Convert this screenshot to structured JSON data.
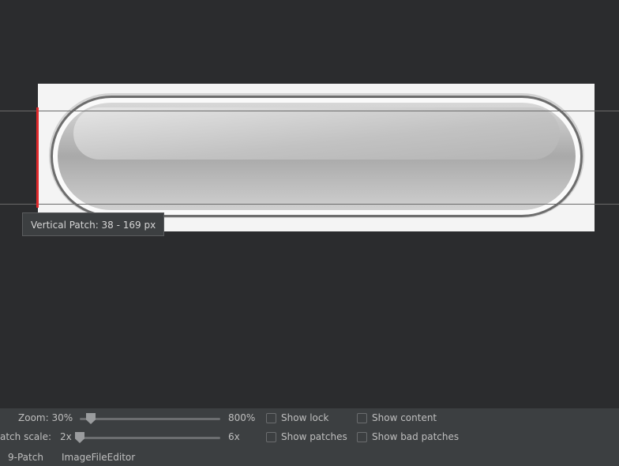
{
  "canvas": {
    "tooltip": "Vertical Patch: 38 - 169 px",
    "patch_color": "#e0292b"
  },
  "controls": {
    "zoom": {
      "label": "Zoom: 30%",
      "max_label": "800%",
      "value_fraction": 0.09
    },
    "patch_scale": {
      "label": "atch scale:",
      "min_label": "2x",
      "max_label": "6x",
      "value_fraction": 0.0
    },
    "checkboxes": {
      "show_lock": {
        "label": "Show lock",
        "checked": false
      },
      "show_content": {
        "label": "Show content",
        "checked": false
      },
      "show_patches": {
        "label": "Show patches",
        "checked": false
      },
      "show_bad_patches": {
        "label": "Show bad patches",
        "checked": false
      }
    }
  },
  "tabs": {
    "nine_patch": "9-Patch",
    "image_file_editor": "ImageFileEditor"
  }
}
